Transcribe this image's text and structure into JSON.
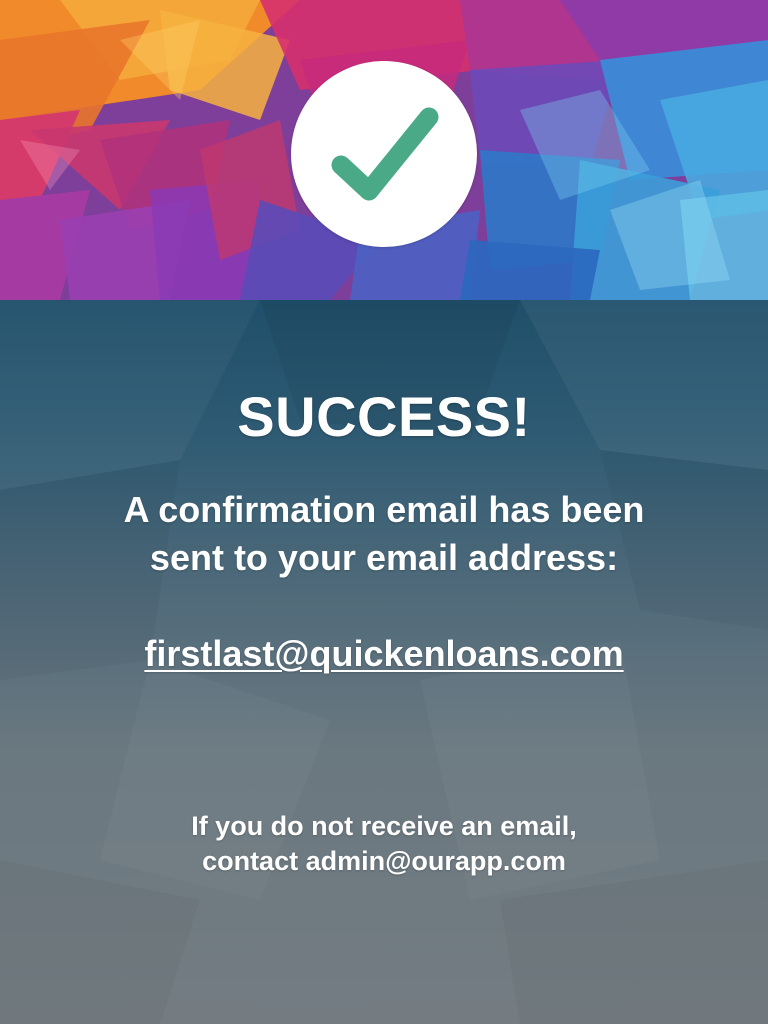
{
  "badge": {
    "icon": "checkmark-icon",
    "icon_color": "#4aaa88",
    "background": "#ffffff"
  },
  "title": "SUCCESS!",
  "message": {
    "line1": "A confirmation email has been",
    "line2": "sent to your email address:"
  },
  "email": "firstlast@quickenloans.com",
  "footer": {
    "line1": "If you do not receive an email,",
    "line2": "contact admin@ourapp.com"
  },
  "colors": {
    "text": "#ffffff",
    "check": "#4aaa88"
  }
}
